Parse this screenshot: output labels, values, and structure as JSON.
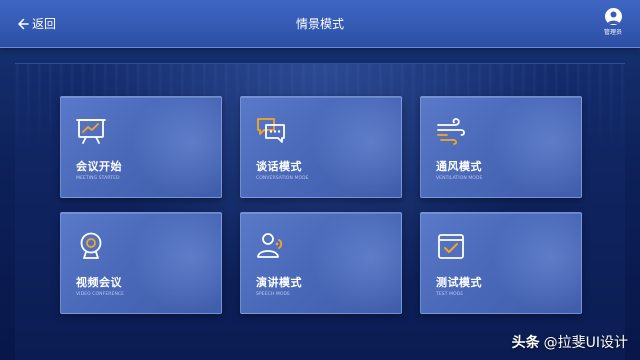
{
  "header": {
    "back_label": "返回",
    "title": "情景模式",
    "user_role": "管理员"
  },
  "colors": {
    "accent": "#f5a623",
    "header_bg": "#3359b3",
    "card_bg": "#4a69b9",
    "background": "#0d215a"
  },
  "modes": [
    {
      "title": "会议开始",
      "subtitle": "MEETING STARTED",
      "icon": "presentation-board-icon"
    },
    {
      "title": "谈话模式",
      "subtitle": "CONVERSATION MODE",
      "icon": "chat-bubbles-icon"
    },
    {
      "title": "通风模式",
      "subtitle": "VENTILATION MODE",
      "icon": "wind-icon"
    },
    {
      "title": "视频会议",
      "subtitle": "VIDEO CONFERENCE",
      "icon": "webcam-icon"
    },
    {
      "title": "演讲模式",
      "subtitle": "SPEECH MODE",
      "icon": "speaker-person-icon"
    },
    {
      "title": "测试模式",
      "subtitle": "TEST MODE",
      "icon": "checklist-window-icon"
    }
  ],
  "watermark": {
    "brand": "头条",
    "handle": "@拉斐UI设计"
  }
}
